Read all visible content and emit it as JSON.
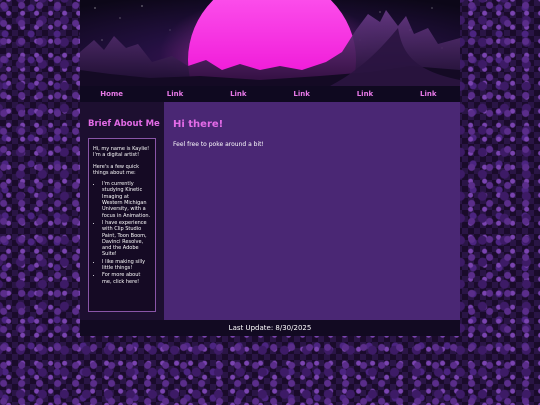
{
  "nav": {
    "items": [
      "Home",
      "Link",
      "Link",
      "Link",
      "Link",
      "Link"
    ]
  },
  "sidebar": {
    "title": "Brief About Me",
    "intro": "Hi, my name is Kaylie! I'm a digital artist!",
    "lead": "Here's a few quick things about me:",
    "bullets": [
      "I'm currently studying Kinetic Imaging at Western Michigan University, with a focus in Animation.",
      "I have experience with Clip Studio Paint, Toon Boom, Davinci Resolve, and the Adobe Suite!",
      "I like making silly little things!",
      "For more about me, click here!"
    ]
  },
  "main": {
    "heading": "Hi there!",
    "text": "Feel free to poke around a bit!"
  },
  "footer": {
    "text": "Last Update: 8/30/2025"
  },
  "colors": {
    "accent": "#e46be8",
    "main_bg": "#4a2774",
    "sidebar_bg": "#1d0f30",
    "nav_bg": "#0f0920"
  }
}
